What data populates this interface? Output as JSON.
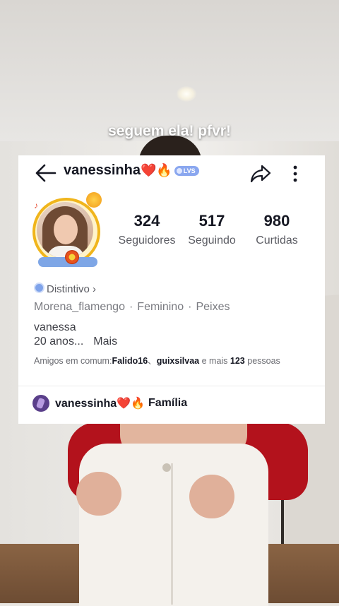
{
  "caption": "seguem ela! pfvr!",
  "profile": {
    "username": "vanessinha",
    "username_emojis": "❤️🔥",
    "level_badge": "LVS",
    "stats": [
      {
        "value": "324",
        "label": "Seguidores"
      },
      {
        "value": "517",
        "label": "Seguindo"
      },
      {
        "value": "980",
        "label": "Curtidas"
      }
    ],
    "badge_label": "Distintivo",
    "badge_chevron": "›",
    "meta": [
      "Morena_flamengo",
      "Feminino",
      "Peixes"
    ],
    "meta_separator": "·",
    "bio_line1": "vanessa",
    "bio_line2": "20 anos...",
    "bio_more": "Mais",
    "friends_prefix": "Amigos em comum:",
    "friend1": "Falido16",
    "friend_sep": "、",
    "friend2": "guixsilvaa",
    "friends_and_more": " e mais ",
    "friends_count": "123",
    "friends_suffix": " pessoas",
    "family_name": "vanessinha❤️🔥",
    "family_label": "Família"
  },
  "icons": {
    "back": "arrow-left-icon",
    "share": "share-arrow-icon",
    "more": "more-vertical-icon"
  },
  "colors": {
    "accent_red": "#e01f3a",
    "badge_blue": "#7fa3ea",
    "text_dark": "#161823",
    "text_gray": "#7a7b81"
  }
}
